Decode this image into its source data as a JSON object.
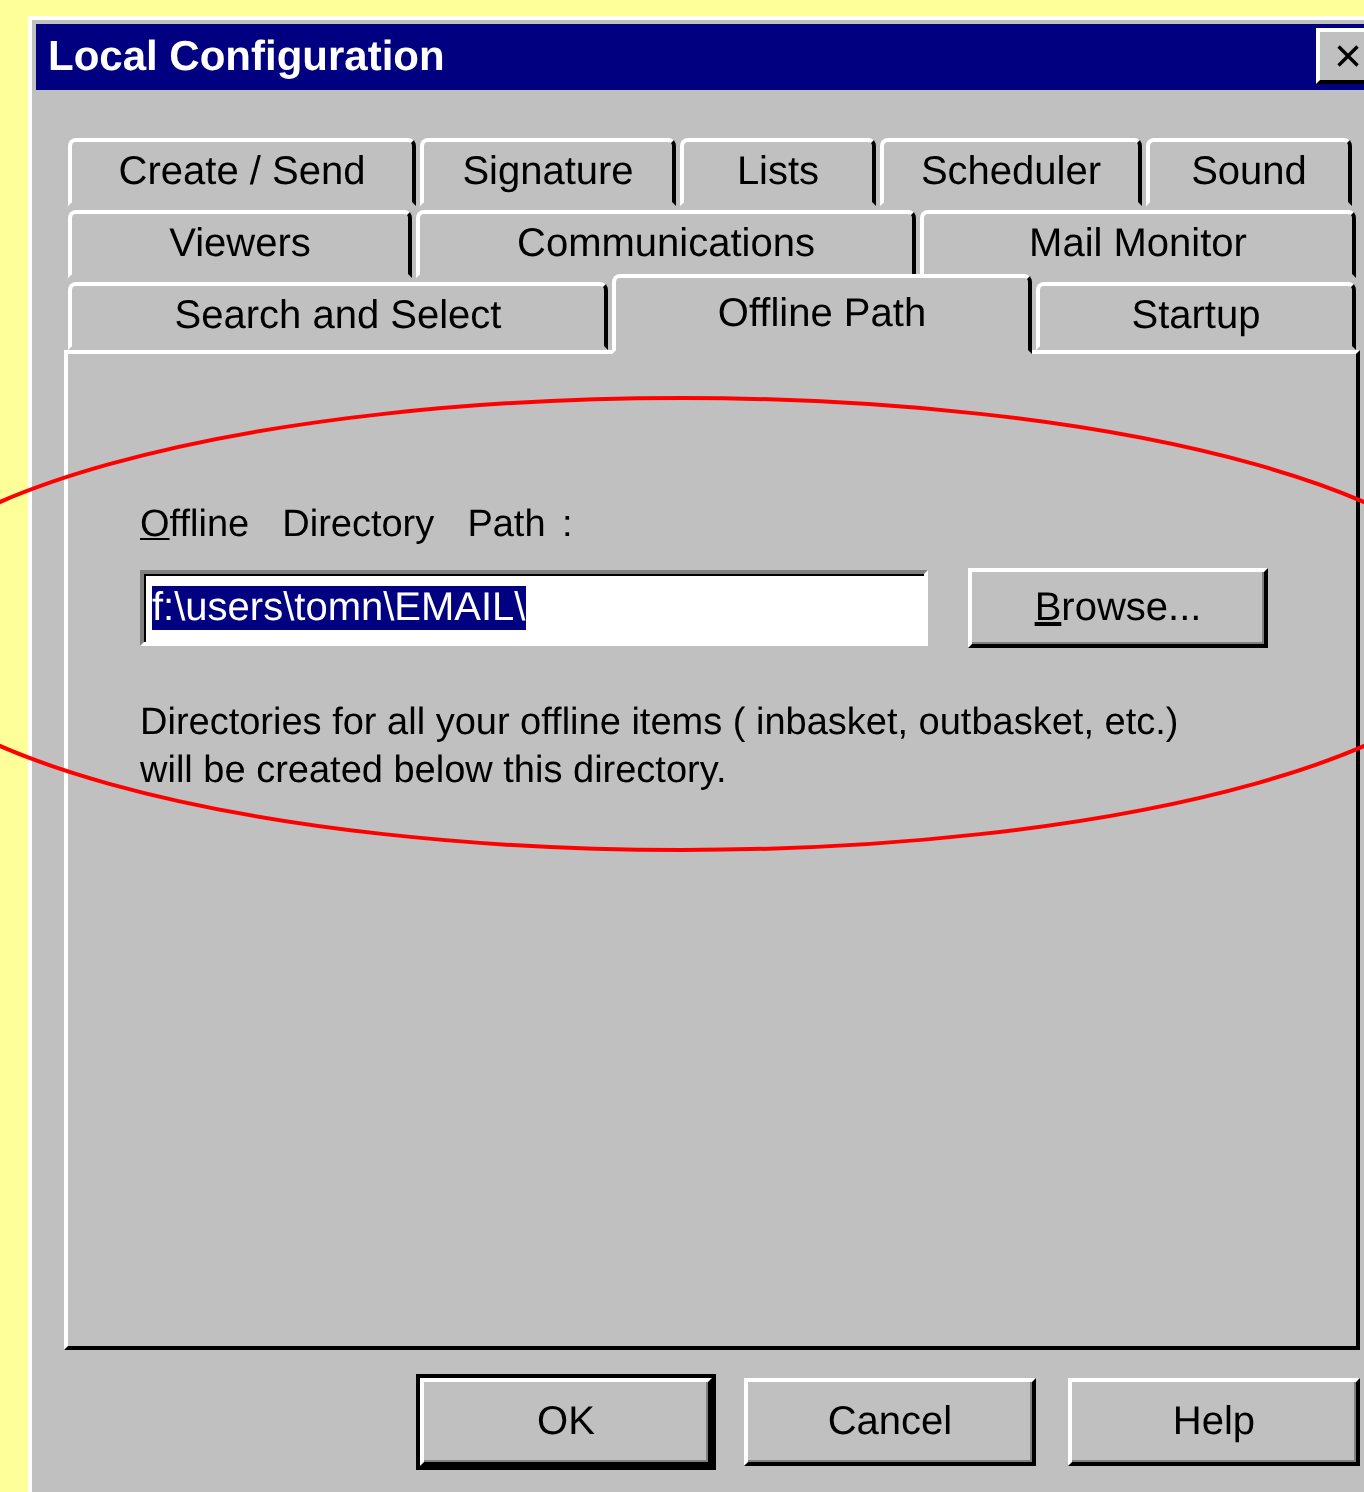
{
  "window": {
    "title": "Local Configuration",
    "close": "×"
  },
  "tab_rows": [
    [
      {
        "label": "Create / Send",
        "selected": false
      },
      {
        "label": "Signature",
        "selected": false
      },
      {
        "label": "Lists",
        "selected": false
      },
      {
        "label": "Scheduler",
        "selected": false
      },
      {
        "label": "Sound",
        "selected": false
      }
    ],
    [
      {
        "label": "Viewers",
        "selected": false
      },
      {
        "label": "Communications",
        "selected": false
      },
      {
        "label": "Mail Monitor",
        "selected": false
      }
    ],
    [
      {
        "label": "Search and Select",
        "selected": false
      },
      {
        "label": "Offline Path",
        "selected": true
      },
      {
        "label": "Startup",
        "selected": false
      }
    ]
  ],
  "path_label": {
    "mnemonic": "O",
    "rest": "ffline  Directory  Path :"
  },
  "path_field": {
    "value": "f:\\users\\tomn\\EMAIL\\",
    "text_selected": true
  },
  "browse_button": {
    "mnemonic": "B",
    "rest": "rowse..."
  },
  "note": "Directories for all your offline items ( inbasket, outbasket, etc.) will be created below this directory.",
  "buttons": [
    {
      "label": "OK",
      "default": true
    },
    {
      "label": "Cancel",
      "default": false
    },
    {
      "label": "Help",
      "default": false
    }
  ],
  "annotation": {
    "kind": "ellipse"
  }
}
